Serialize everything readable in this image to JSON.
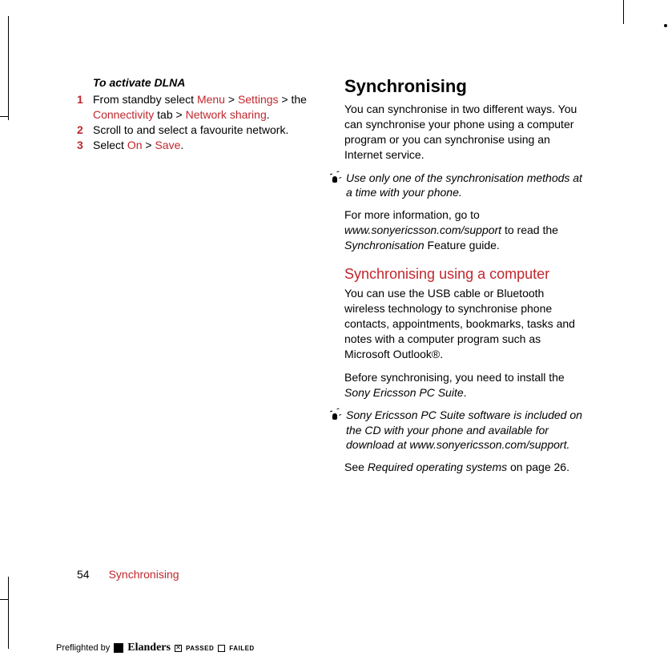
{
  "left": {
    "subheading": "To activate DLNA",
    "step1_num": "1",
    "step1_a": "From standby select ",
    "step1_menu": "Menu",
    "step1_gt1": " > ",
    "step1_settings": "Settings",
    "step1_gt2": " > the ",
    "step1_conn": "Connectivity",
    "step1_tab": " tab > ",
    "step1_net": "Network sharing",
    "step1_dot": ".",
    "step2_num": "2",
    "step2_text": "Scroll to and select a favourite network.",
    "step3_num": "3",
    "step3_a": "Select ",
    "step3_on": "On",
    "step3_gt": " > ",
    "step3_save": "Save",
    "step3_dot": "."
  },
  "right": {
    "h1": "Synchronising",
    "p1": "You can synchronise in two different ways. You can synchronise your phone using a computer program or you can synchronise using an Internet service.",
    "note1": "Use only one of the synchronisation methods at a time with your phone.",
    "p2a": "For more information, go to ",
    "p2b": "www.sonyericsson.com/support",
    "p2c": " to read the ",
    "p2d": "Synchronisation",
    "p2e": " Feature guide.",
    "h2": "Synchronising using a computer",
    "p3": "You can use the USB cable or Bluetooth wireless technology to synchronise phone contacts, appointments, bookmarks, tasks and notes with a computer program such as Microsoft Outlook®.",
    "p4a": "Before synchronising, you need to install the ",
    "p4b": "Sony Ericsson PC Suite",
    "p4c": ".",
    "note2": "Sony Ericsson PC Suite software is included on the CD with your phone and available for download at www.sonyericsson.com/support.",
    "p5a": "See ",
    "p5b": "Required operating systems",
    "p5c": " on page 26."
  },
  "footer": {
    "page": "54",
    "section": "Synchronising"
  },
  "preflight": {
    "label": "Preflighted by",
    "brand": "Elanders",
    "passed": "PASSED",
    "passed_mark": "✕",
    "failed": "FAILED"
  }
}
